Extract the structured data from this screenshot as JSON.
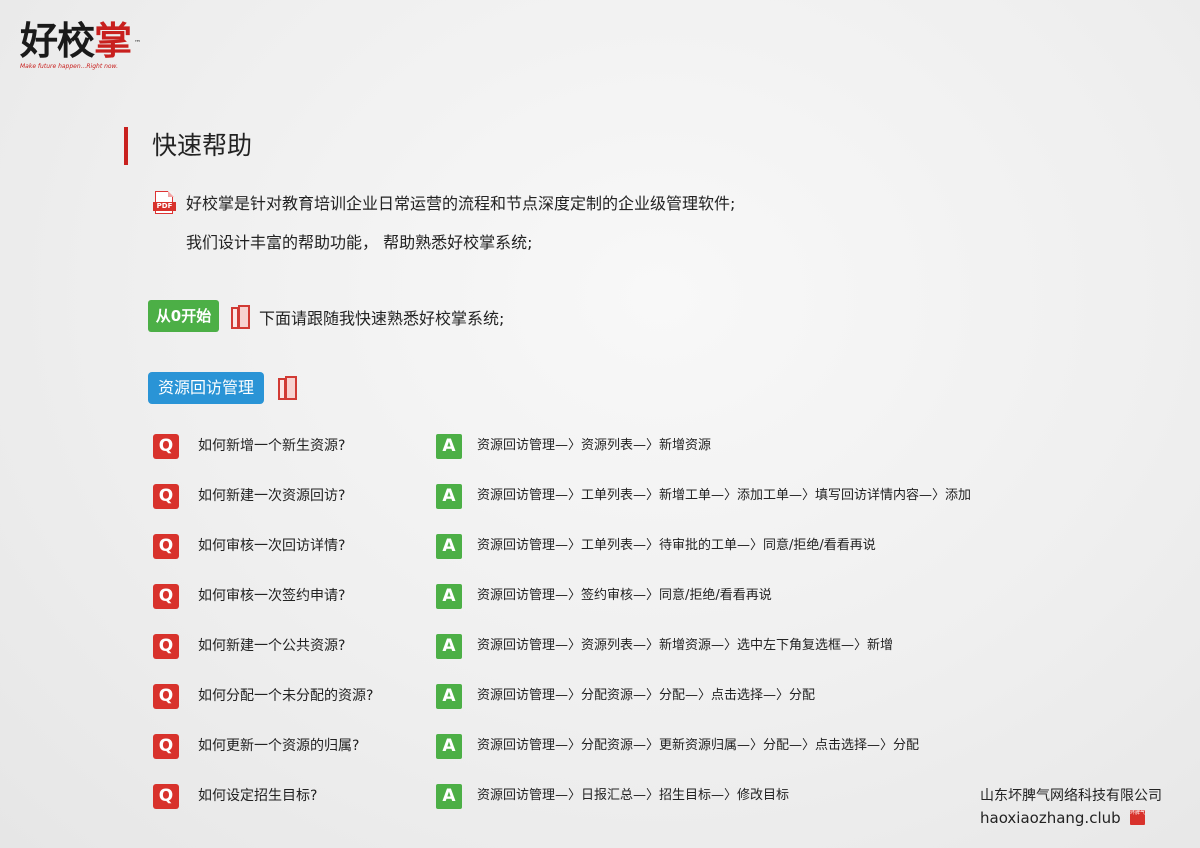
{
  "logo": {
    "main": "好校",
    "accent": "掌",
    "tm": "™",
    "slogan": "Make future happen...Right now.",
    "accent_color": "#c8201e"
  },
  "page_title": "快速帮助",
  "intro": {
    "icon": "pdf-icon",
    "icon_label": "PDF",
    "line1": "好校掌是针对教育培训企业日常运营的流程和节点深度定制的企业级管理软件;",
    "line2": "我们设计丰富的帮助功能，  帮助熟悉好校掌系统;"
  },
  "start": {
    "badge": "从0开始",
    "icon": "book-icon",
    "text": "下面请跟随我快速熟悉好校掌系统;"
  },
  "section": {
    "badge": "资源回访管理",
    "icon": "book-icon"
  },
  "qa": {
    "q_label": "Q",
    "a_label": "A",
    "items": [
      {
        "q": "如何新增一个新生资源?",
        "a": "资源回访管理—〉资源列表—〉新增资源"
      },
      {
        "q": "如何新建一次资源回访?",
        "a": "资源回访管理—〉工单列表—〉新增工单—〉添加工单—〉填写回访详情内容—〉添加"
      },
      {
        "q": "如何审核一次回访详情?",
        "a": "资源回访管理—〉工单列表—〉待审批的工单—〉同意/拒绝/看看再说"
      },
      {
        "q": "如何审核一次签约申请?",
        "a": "资源回访管理—〉签约审核—〉同意/拒绝/看看再说"
      },
      {
        "q": "如何新建一个公共资源?",
        "a": "资源回访管理—〉资源列表—〉新增资源—〉选中左下角复选框—〉新增"
      },
      {
        "q": "如何分配一个未分配的资源?",
        "a": "资源回访管理—〉分配资源—〉分配—〉点击选择—〉分配"
      },
      {
        "q": "如何更新一个资源的归属?",
        "a": "资源回访管理—〉分配资源—〉更新资源归属—〉分配—〉点击选择—〉分配"
      },
      {
        "q": "如何设定招生目标?",
        "a": "资源回访管理—〉日报汇总—〉招生目标—〉修改目标"
      }
    ]
  },
  "footer": {
    "company": "山东坏脾气网络科技有限公司",
    "website": "haoxiaozhang.club",
    "stamp_icon": "seal-stamp-icon",
    "stamp_text": "坏脾气"
  },
  "colors": {
    "red": "#d8322c",
    "green": "#4caf46",
    "blue": "#2a94d6"
  }
}
